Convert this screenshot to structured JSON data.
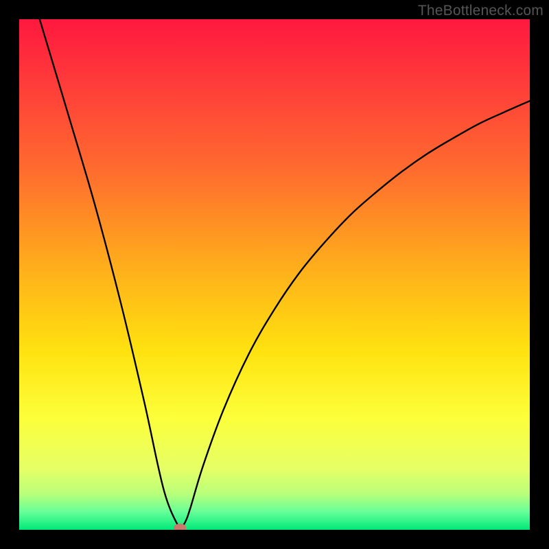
{
  "watermark": "TheBottleneck.com",
  "chart_data": {
    "type": "line",
    "title": "",
    "xlabel": "",
    "ylabel": "",
    "xlim": [
      0,
      1
    ],
    "ylim": [
      0,
      1
    ],
    "notes": "V-shaped bottleneck curve over a vertical red-to-green gradient background. No axis ticks or numeric labels are rendered; values below are normalized estimates (0–1) read from pixel geometry.",
    "series": [
      {
        "name": "bottleneck-curve",
        "x": [
          0.04,
          0.1,
          0.15,
          0.2,
          0.245,
          0.284,
          0.315,
          0.325,
          0.335,
          0.36,
          0.4,
          0.45,
          0.5,
          0.55,
          0.6,
          0.65,
          0.7,
          0.75,
          0.8,
          0.85,
          0.9,
          0.95,
          1.0
        ],
        "y": [
          1.0,
          0.8,
          0.63,
          0.44,
          0.25,
          0.075,
          0.0,
          0.015,
          0.042,
          0.125,
          0.235,
          0.345,
          0.432,
          0.505,
          0.565,
          0.618,
          0.662,
          0.702,
          0.737,
          0.767,
          0.795,
          0.818,
          0.84
        ]
      }
    ],
    "marker": {
      "x": 0.315,
      "y": 0.004,
      "color": "#c97a6c"
    },
    "gradient_stops": [
      {
        "offset": 0.0,
        "color": "#ff183f"
      },
      {
        "offset": 0.12,
        "color": "#ff3a3a"
      },
      {
        "offset": 0.3,
        "color": "#ff6d2e"
      },
      {
        "offset": 0.5,
        "color": "#ffb31a"
      },
      {
        "offset": 0.65,
        "color": "#ffe20f"
      },
      {
        "offset": 0.78,
        "color": "#fcff3a"
      },
      {
        "offset": 0.88,
        "color": "#e6ff66"
      },
      {
        "offset": 0.93,
        "color": "#b8ff7a"
      },
      {
        "offset": 0.965,
        "color": "#66ff99"
      },
      {
        "offset": 1.0,
        "color": "#00e878"
      }
    ]
  }
}
